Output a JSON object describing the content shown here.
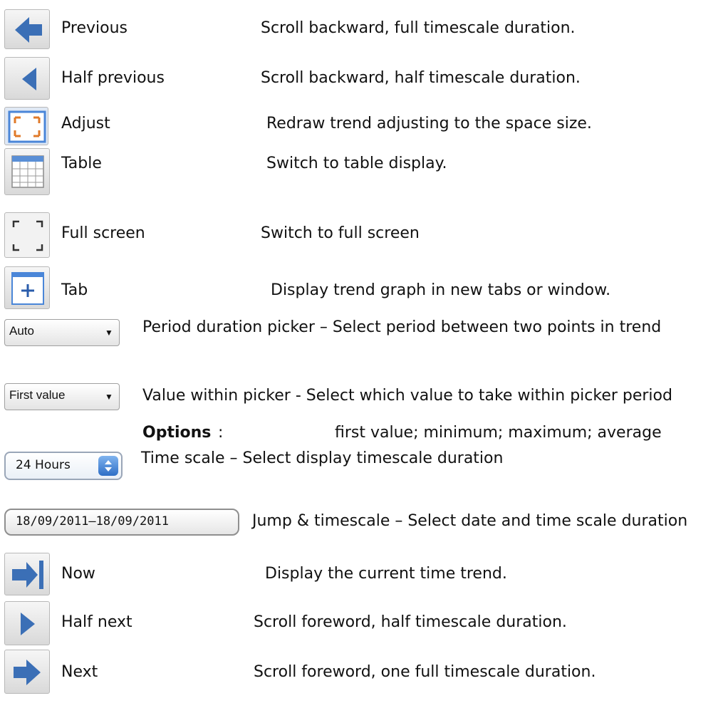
{
  "rows": [
    {
      "label": "Previous",
      "desc": "Scroll backward, full timescale duration.",
      "icon": "arrow-left-icon"
    },
    {
      "label": "Half previous",
      "desc": "Scroll backward, half timescale duration.",
      "icon": "triangle-left-icon"
    },
    {
      "label": "Adjust",
      "desc": "Redraw trend adjusting to the space size.",
      "icon": "fit-frame-icon"
    },
    {
      "label": "Table",
      "desc": "Switch to table display.",
      "icon": "table-icon"
    },
    {
      "label": "Full screen",
      "desc": "Switch to full screen",
      "icon": "fullscreen-icon"
    },
    {
      "label": "Tab",
      "desc": "Display trend graph in new tabs or window.",
      "icon": "new-tab-icon"
    },
    {
      "control": "Auto",
      "arrow": "▼",
      "desc": "Period duration picker – Select period between two points in trend"
    },
    {
      "control": "First value",
      "arrow": "▼",
      "desc": "Value within picker   - Select which value to take within picker period"
    },
    {
      "options_label": "Options",
      "options_colon": ":",
      "options_text": "first value; minimum; maximum; average"
    },
    {
      "control": "24 Hours",
      "desc": "Time scale – Select display timescale duration"
    },
    {
      "control": "18/09/2011–18/09/2011",
      "desc": "Jump & timescale – Select date and time scale duration"
    },
    {
      "label": "Now",
      "desc": "Display the current time trend.",
      "icon": "arrow-to-end-icon"
    },
    {
      "label": "Half next",
      "desc": "Scroll foreword, half timescale duration.",
      "icon": "triangle-right-icon"
    },
    {
      "label": "Next",
      "desc": "Scroll foreword, one full timescale duration.",
      "icon": "arrow-right-icon"
    }
  ],
  "colors": {
    "icon_blue": "#3b6fb6",
    "icon_orange": "#e07a2a",
    "frame_blue": "#4a86d8"
  }
}
